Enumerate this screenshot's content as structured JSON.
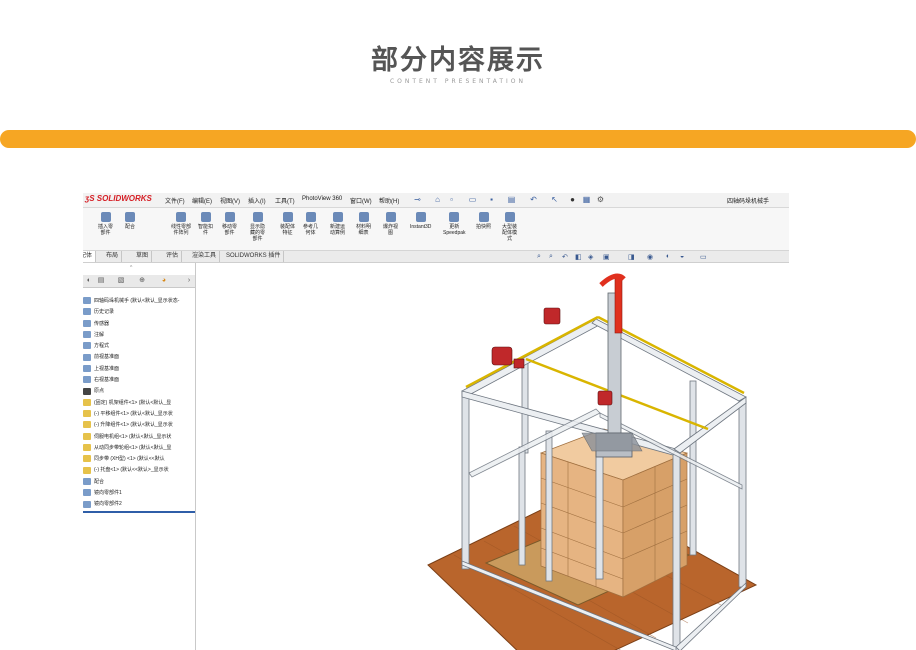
{
  "page": {
    "title": "部分内容展示",
    "subtitle": "CONTENT PRESENTATION",
    "accent_color": "#f6a623"
  },
  "solidworks": {
    "logo": "SOLIDWORKS",
    "menu": [
      "文件(F)",
      "编辑(E)",
      "视图(V)",
      "插入(I)",
      "工具(T)",
      "PhotoView 360",
      "窗口(W)",
      "帮助(H)"
    ],
    "quick_access_icons": [
      "pin-icon",
      "home-icon",
      "new-icon",
      "open-icon",
      "save-icon",
      "print-icon",
      "undo-icon",
      "select-icon",
      "rebuild-icon",
      "file-properties-icon",
      "options-icon"
    ],
    "document_title": "四轴码垛机械手",
    "ribbon_buttons": [
      "插入零\n部件",
      "配合",
      "线性零部\n件阵列",
      "智能扣\n件",
      "移动零\n部件",
      "显示隐\n藏的零\n部件",
      "装配体\n特征",
      "参考几\n何体",
      "新建运\n动算例",
      "材料明\n细表",
      "爆炸视\n图",
      "Instant3D",
      "更新\nSpeedpak",
      "拍快照",
      "大型装\n配体模\n式"
    ],
    "tabs": [
      "装配体",
      "布局",
      "草图",
      "评估",
      "渲染工具",
      "SOLIDWORKS 插件"
    ],
    "feature_tree": [
      "四轴码垛机械手 (默认<默认_显示状态-",
      "历史记录",
      "传感器",
      "注解",
      "方程式",
      "前视基准面",
      "上视基准面",
      "右视基准面",
      "原点",
      "(固定) 机架组件<1> (默认<默认_显",
      "(-) 平移组件<1> (默认<默认_显示状",
      "(-) 升降组件<1> (默认<默认_显示状",
      "伺服电机组<1> (默认<默认_显示状",
      "从动同步带轮组<1> (默认<默认_显",
      "同步带 (XH型) <1> (默认<<默认",
      "(-) 托盘<1> (默认<<默认>_显示状",
      "配合",
      "镜向零部件1",
      "镜向零部件2"
    ]
  }
}
